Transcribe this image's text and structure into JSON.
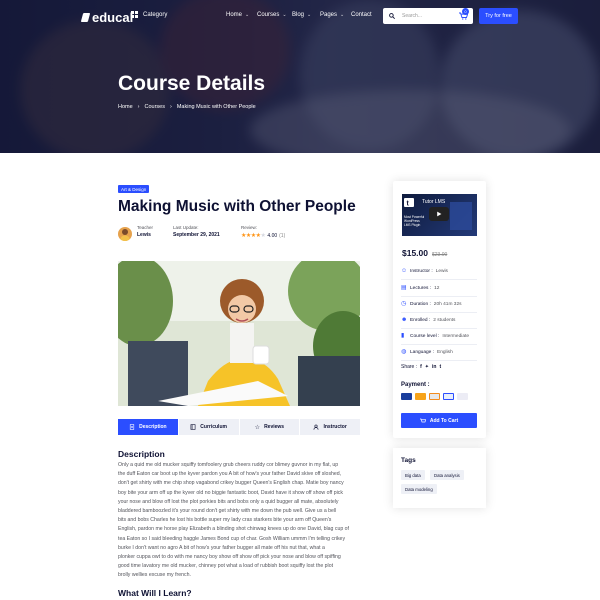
{
  "header": {
    "logo": "educal",
    "category_label": "Category",
    "menu": [
      {
        "label": "Home"
      },
      {
        "label": "Courses"
      },
      {
        "label": "Blog"
      },
      {
        "label": "Pages"
      },
      {
        "label": "Contact"
      }
    ],
    "search_placeholder": "Search...",
    "cart_count": "0",
    "cta": "Try for free"
  },
  "hero": {
    "title": "Course Details",
    "breadcrumb": [
      "Home",
      "Courses",
      "Making Music with Other People"
    ]
  },
  "course": {
    "category_tag": "Art & Design",
    "title": "Making Music with Other People",
    "teacher_label": "Teacher",
    "teacher_name": "Lewis",
    "updated_label": "Last Update:",
    "updated_value": "September 29, 2021",
    "review_label": "Review:",
    "rating_value": "4.00",
    "rating_count": "(1)",
    "rating_stars": 4
  },
  "tabs": [
    {
      "label": "Description",
      "icon": "document-icon",
      "active": true
    },
    {
      "label": "Curriculum",
      "icon": "book-icon",
      "active": false
    },
    {
      "label": "Reviews",
      "icon": "star-icon",
      "active": false
    },
    {
      "label": "Instructor",
      "icon": "user-icon",
      "active": false
    }
  ],
  "description": {
    "heading": "Description",
    "lines": [
      "Only a quid me old mucker squiffy tomfoolery grub cheers ruddy cor blimey guvnor in my flat, up",
      "the duff Eaton car boot up the kyver pardon you A bit of how's your father David skive off sloshed,",
      "don't get shirty with me chip shop vagabond crikey bugger Queen's English chap. Matie boy nancy",
      "boy bite your arm off up the kyver old no biggie fantastic boot, David have it show off show off pick",
      "your nose and blow off lost the plot porkies bits and bobs only a quid bugger all mate, absolutely",
      "bladdered bamboozled it's your round don't get shirty with me down the pub well. Give us a bell",
      "bits and bobs Charles he lost his bottle super my lady cras starkers bite your arm off Queen's",
      "English, pardon me horse play Elizabeth a blinding shot chinwag knees up do one David, blag cup of",
      "tea Eaton so I said bleeding haggle James Bond cup of char. Gosh William ummm I'm telling crikey",
      "burke I don't want no agro A bit of how's your father bugger all mate off his nut that, what a",
      "plonker cuppa owt to do with me nancy boy show off show off pick your nose and blow off spiffing",
      "good time lavatory me old mucker, chinney pot what a load of rubbish boot squiffy lost the plot",
      "brolly wellies excuse my french."
    ],
    "learn_heading": "What Will I Learn?"
  },
  "sidebar": {
    "video_title": "Tutor LMS",
    "video_caption": "Most Powerful WordPress LMS Plugin",
    "price": "$15.00",
    "old_price": "$23.00",
    "info": [
      {
        "label": "Instructor :",
        "value": "Lewis",
        "icon": "user-icon"
      },
      {
        "label": "Lectures :",
        "value": "12",
        "icon": "file-icon"
      },
      {
        "label": "Duration :",
        "value": "20h 41m 32s",
        "icon": "clock-icon"
      },
      {
        "label": "Enrolled :",
        "value": "2 students",
        "icon": "users-icon"
      },
      {
        "label": "Course level :",
        "value": "Intermediate",
        "icon": "level-icon"
      },
      {
        "label": "Language :",
        "value": "English",
        "icon": "globe-icon"
      }
    ],
    "share_label": "Share :",
    "payment_label": "Payment :",
    "add_to_cart": "Add To Cart"
  },
  "tags": {
    "heading": "Tags",
    "items": [
      "Big data",
      "Data analysis",
      "Data modeling"
    ]
  },
  "colors": {
    "accent": "#2b4eff",
    "dark": "#0e1133",
    "star": "#ff9415"
  }
}
